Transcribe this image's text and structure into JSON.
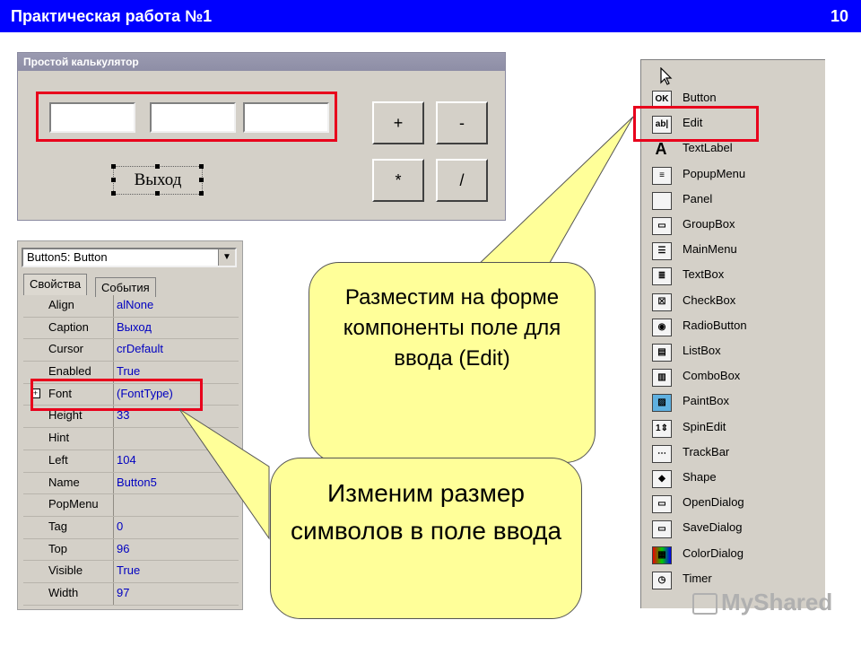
{
  "header": {
    "title": "Практическая работа №1",
    "slide_number": "10"
  },
  "calculator": {
    "window_title": "Простой калькулятор",
    "buttons": [
      "+",
      "-",
      "*",
      "/"
    ],
    "exit_button": "Выход"
  },
  "inspector": {
    "object_selector": "Button5: Button",
    "tabs": [
      "Свойства",
      "События"
    ],
    "properties": [
      {
        "name": "Align",
        "value": "alNone"
      },
      {
        "name": "Caption",
        "value": "Выход"
      },
      {
        "name": "Cursor",
        "value": "crDefault"
      },
      {
        "name": "Enabled",
        "value": "True"
      },
      {
        "name": "Font",
        "value": "(FontType)"
      },
      {
        "name": "Height",
        "value": "33"
      },
      {
        "name": "Hint",
        "value": ""
      },
      {
        "name": "Left",
        "value": "104"
      },
      {
        "name": "Name",
        "value": "Button5"
      },
      {
        "name": "PopMenu",
        "value": ""
      },
      {
        "name": "Tag",
        "value": "0"
      },
      {
        "name": "Top",
        "value": "96"
      },
      {
        "name": "Visible",
        "value": "True"
      },
      {
        "name": "Width",
        "value": "97"
      }
    ]
  },
  "palette": {
    "items": [
      "Button",
      "Edit",
      "TextLabel",
      "PopupMenu",
      "Panel",
      "GroupBox",
      "MainMenu",
      "TextBox",
      "CheckBox",
      "RadioButton",
      "ListBox",
      "ComboBox",
      "PaintBox",
      "SpinEdit",
      "TrackBar",
      "Shape",
      "OpenDialog",
      "SaveDialog",
      "ColorDialog",
      "Timer"
    ]
  },
  "callouts": {
    "edit_note": "Разместим на форме компоненты поле для ввода (Edit)",
    "font_note": "Изменим размер символов в поле ввода"
  },
  "watermark": "MyShared",
  "colors": {
    "header_bg": "#0000ff",
    "highlight": "#e8001c",
    "callout_bg": "#ffff99",
    "value_text": "#0000c0"
  }
}
